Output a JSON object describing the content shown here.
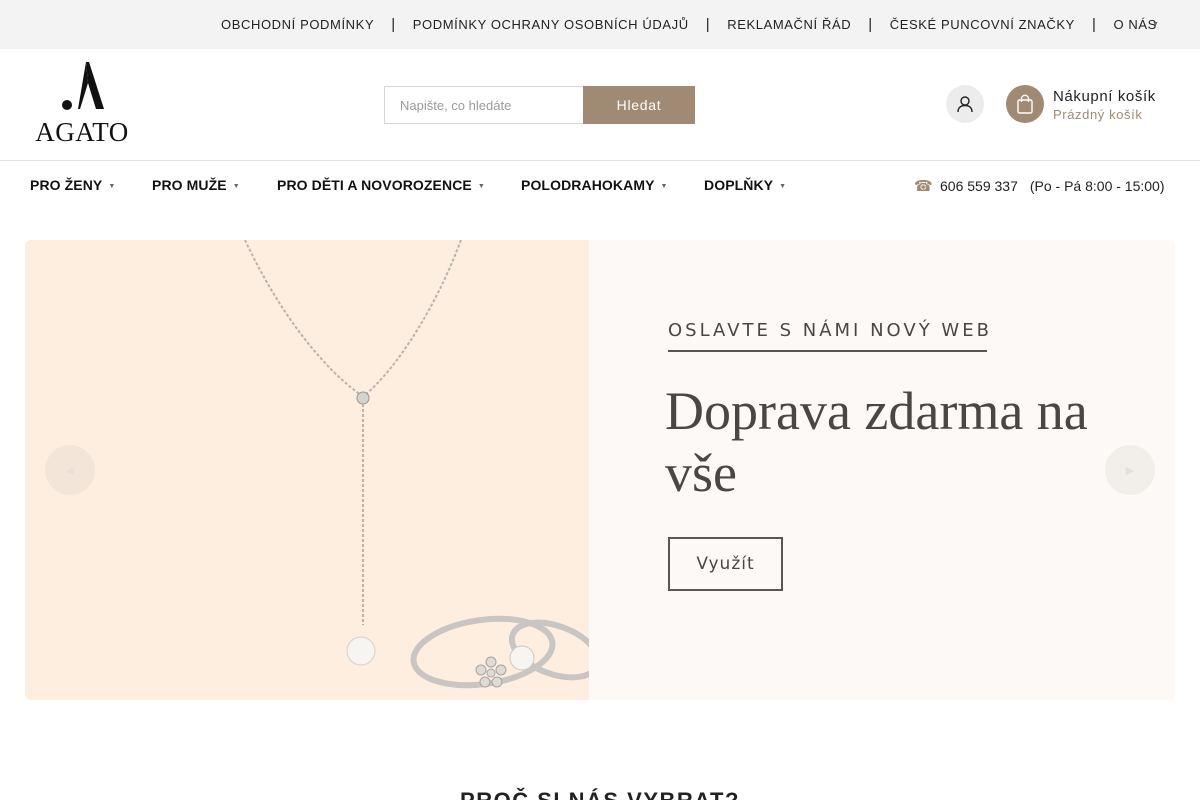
{
  "topbar": {
    "links": [
      "OBCHODNÍ PODMÍNKY",
      "PODMÍNKY OCHRANY OSOBNÍCH ÚDAJŮ",
      "REKLAMAČNÍ ŘÁD",
      "ČESKÉ PUNCOVNÍ ZNAČKY",
      "O NÁS"
    ],
    "separator": "|",
    "more_icon": "chevron-down-icon"
  },
  "header": {
    "logo_text": "AGATO",
    "search": {
      "placeholder": "Napište, co hledáte",
      "button_label": "Hledat"
    },
    "user_icon": "user-icon",
    "cart": {
      "icon": "shopping-bag-icon",
      "title": "Nákupní košík",
      "status": "Prázdný košík"
    }
  },
  "nav": {
    "items": [
      "PRO ŽENY",
      "PRO MUŽE",
      "PRO DĚTI A NOVOROZENCE",
      "POLODRAHOKAMY",
      "DOPLŇKY"
    ],
    "phone_icon": "phone-icon",
    "phone": "606 559 337",
    "hours": "(Po - Pá 8:00 - 15:00)"
  },
  "hero": {
    "eyebrow": "OSLAVTE S NÁMI NOVÝ WEB",
    "title": "Doprava zdarma na vše",
    "cta_label": "Využít",
    "prev_icon": "chevron-left-icon",
    "next_icon": "chevron-right-icon"
  },
  "section": {
    "why_title": "PROČ SI NÁS VYBRAT?"
  },
  "colors": {
    "accent": "#a08a73",
    "topbar_bg": "#f3f3f3",
    "hero_left_bg": "#fdeee0",
    "hero_right_bg": "#fcf9f7",
    "hero_text": "#4a4644"
  }
}
